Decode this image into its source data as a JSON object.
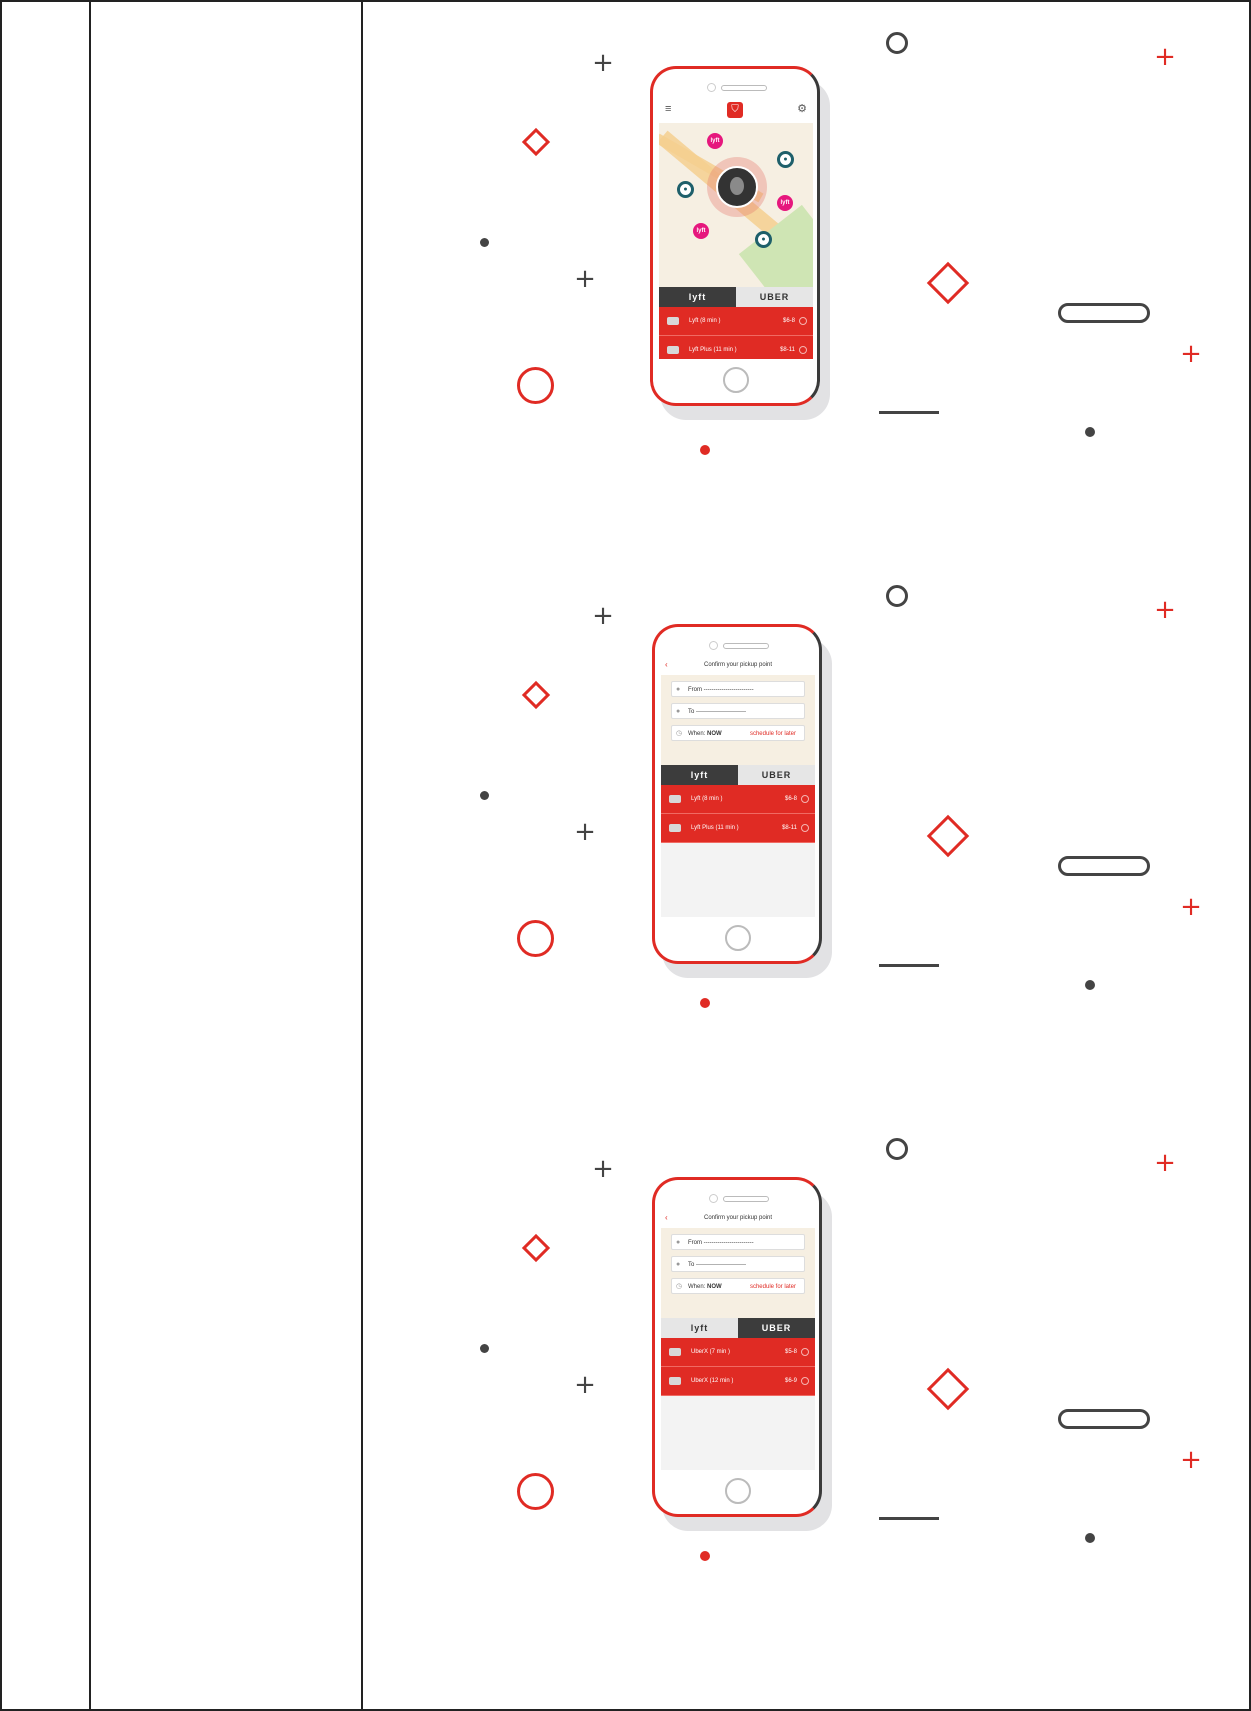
{
  "screens": [
    {
      "type": "map",
      "tabs": {
        "left": "lyft",
        "right": "UBER",
        "active": "left"
      },
      "rides": [
        {
          "name": "Lyft     (8 min )",
          "price": "$6-8"
        },
        {
          "name": "Lyft Plus    (11 min )",
          "price": "$8-11"
        }
      ],
      "pins": {
        "lyft": "lyft"
      }
    },
    {
      "type": "confirm",
      "header": "Confirm your pickup point",
      "from": "From  -------------------------",
      "to": "To  -------------------------",
      "when_label": "When:",
      "when_value": "NOW",
      "schedule": "schedule for later",
      "tabs": {
        "left": "lyft",
        "right": "UBER",
        "active": "left"
      },
      "rides": [
        {
          "name": "Lyft     (8 min )",
          "price": "$6-8"
        },
        {
          "name": "Lyft Plus    (11 min )",
          "price": "$8-11"
        }
      ]
    },
    {
      "type": "confirm",
      "header": "Confirm your pickup point",
      "from": "From  -------------------------",
      "to": "To  -------------------------",
      "when_label": "When:",
      "when_value": "NOW",
      "schedule": "schedule for later",
      "tabs": {
        "left": "lyft",
        "right": "UBER",
        "active": "right"
      },
      "rides": [
        {
          "name": "UberX     (7 min )",
          "price": "$5-8"
        },
        {
          "name": "UberX     (12 min )",
          "price": "$6-9"
        }
      ]
    }
  ],
  "icons": {
    "plus": "+",
    "menu": "≡",
    "gear": "⚙",
    "back": "‹",
    "pin": "●",
    "clock": "◷",
    "logo": "⛉"
  },
  "colors": {
    "accent": "#e02b24",
    "dark": "#444444",
    "uber": "#1e5f6a",
    "lyft": "#e6177d"
  }
}
